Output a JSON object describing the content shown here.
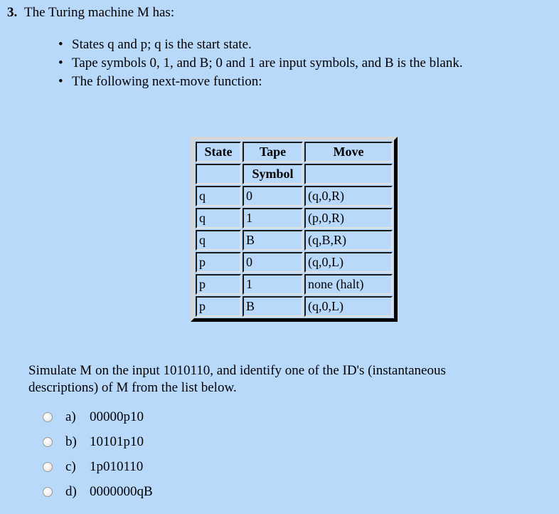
{
  "question": {
    "number": "3.",
    "stem": "The Turing machine M has:",
    "bullet_marker": "•",
    "bullets": [
      "States q and p; q is the start state.",
      "Tape symbols 0, 1, and B; 0 and 1 are input symbols, and B is the blank.",
      "The following next-move function:"
    ]
  },
  "table": {
    "headers": {
      "state": "State",
      "tape": "Tape",
      "symbol": "Symbol",
      "move": "Move"
    },
    "rows": [
      {
        "state": "q",
        "symbol": "0",
        "move": "(q,0,R)"
      },
      {
        "state": "q",
        "symbol": "1",
        "move": "(p,0,R)"
      },
      {
        "state": "q",
        "symbol": "B",
        "move": "(q,B,R)"
      },
      {
        "state": "p",
        "symbol": "0",
        "move": "(q,0,L)"
      },
      {
        "state": "p",
        "symbol": "1",
        "move": "none (halt)"
      },
      {
        "state": "p",
        "symbol": "B",
        "move": "(q,0,L)"
      }
    ]
  },
  "prompt": "Simulate M on the input 1010110, and identify one of the ID's (instantaneous descriptions) of M from the list below.",
  "options": [
    {
      "letter": "a)",
      "text": "00000p10",
      "selected": false
    },
    {
      "letter": "b)",
      "text": "10101p10",
      "selected": false
    },
    {
      "letter": "c)",
      "text": "1p010110",
      "selected": false
    },
    {
      "letter": "d)",
      "text": "0000000qB",
      "selected": false
    }
  ],
  "colors": {
    "page_background": "#b9d9fb",
    "text": "#000000",
    "table_frame_light": "#d6d6d6",
    "table_frame_dark": "#2b2b2b"
  }
}
